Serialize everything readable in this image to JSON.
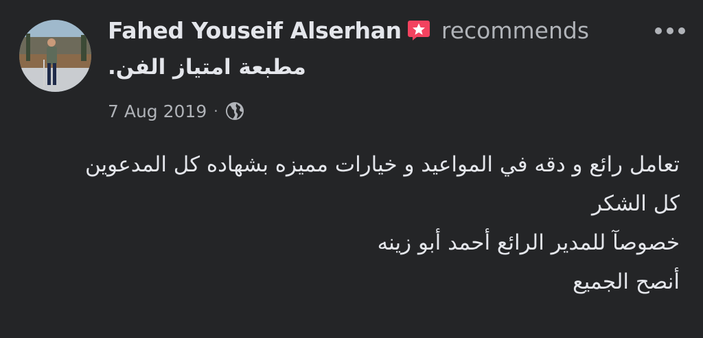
{
  "post": {
    "author": "Fahed Youseif Alserhan",
    "recommend_icon": "recommend-star-badge-icon",
    "action": "recommends",
    "page_name": "مطبعة امتياز الفن.",
    "date": "7 Aug 2019",
    "separator": "·",
    "privacy_icon": "globe-icon",
    "more_icon": "more-options-icon",
    "body_lines": [
      "تعامل رائع و دقه في المواعيد و خيارات مميزه بشهاده كل المدعوين",
      "كل الشكر",
      "خصوصآ للمدير الرائع أحمد أبو زينه",
      "أنصح الجميع"
    ]
  },
  "colors": {
    "background": "#242527",
    "primary_text": "#e4e6eb",
    "secondary_text": "#b0b3b8",
    "recommend_badge": "#f3425f"
  }
}
